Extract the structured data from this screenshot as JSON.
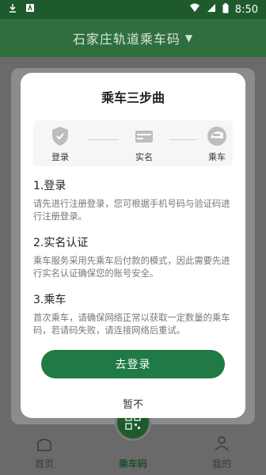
{
  "status_bar": {
    "time": "8:50",
    "icons": [
      "download-icon",
      "app-icon",
      "wifi-icon",
      "signal-icon",
      "battery-icon"
    ]
  },
  "header": {
    "title": "石家庄轨道乘车码",
    "dropdown_icon": "chevron-down-icon"
  },
  "modal": {
    "title": "乘车三步曲",
    "steps": [
      {
        "label": "登录",
        "icon": "shield-icon"
      },
      {
        "label": "实名",
        "icon": "id-card-icon"
      },
      {
        "label": "乘车",
        "icon": "train-icon"
      }
    ],
    "sections": [
      {
        "title": "1.登录",
        "text": "请先进行注册登录，您可根据手机号码与验证码进行注册登录。"
      },
      {
        "title": "2.实名认证",
        "text": "乘车服务采用先乘车后付款的模式，因此需要先进行实名认证确保您的账号安全。"
      },
      {
        "title": "3.乘车",
        "text": "首次乘车，请确保网络正常以获取一定数量的乘车码，若请码失败，请连接网络后重试。"
      }
    ],
    "primary_button": "去登录",
    "secondary_button": "暂不"
  },
  "bottom_nav": {
    "items": [
      {
        "label": "首页",
        "icon": "home-icon"
      },
      {
        "label": "乘车码",
        "icon": "qr-code-icon"
      },
      {
        "label": "我的",
        "icon": "user-icon"
      }
    ]
  },
  "colors": {
    "brand_green": "#2f6f3d",
    "button_green": "#1f7a45"
  }
}
